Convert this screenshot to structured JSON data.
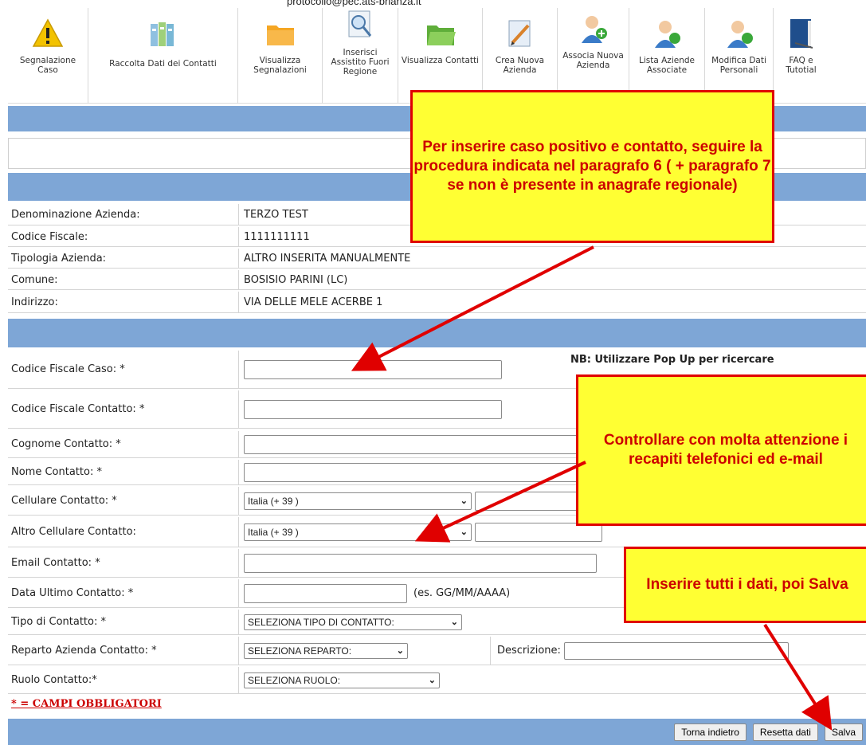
{
  "header": {
    "email": "protocollo@pec.ats-brianza.it"
  },
  "toolbar": [
    {
      "label": "Segnalazione Caso",
      "icon": "warning-icon",
      "w": 100
    },
    {
      "label": "Raccolta Dati dei Contatti",
      "icon": "books-icon",
      "w": 190
    },
    {
      "label": "Visualizza Segnalazioni",
      "icon": "folder-icon",
      "w": 105
    },
    {
      "label": "Inserisci Assistito Fuori Regione",
      "icon": "search-doc-icon",
      "w": 95
    },
    {
      "label": "Visualizza Contatti",
      "icon": "open-folder-icon",
      "w": 105
    },
    {
      "label": "Crea Nuova Azienda",
      "icon": "pencil-doc-icon",
      "w": 95
    },
    {
      "label": "Associa Nuova Azienda",
      "icon": "add-user-icon",
      "w": 90
    },
    {
      "label": "Lista Aziende Associate",
      "icon": "user-icon",
      "w": 95
    },
    {
      "label": "Modifica Dati Personali",
      "icon": "user-edit-icon",
      "w": 85
    },
    {
      "label": "FAQ e Tutotial",
      "icon": "book-icon",
      "w": 60
    }
  ],
  "company": {
    "rows": [
      {
        "label": "Denominazione Azienda:",
        "value": "TERZO TEST"
      },
      {
        "label": "Codice Fiscale:",
        "value": "1111111111"
      },
      {
        "label": "Tipologia Azienda:",
        "value": "ALTRO INSERITA MANUALMENTE"
      },
      {
        "label": "Comune:",
        "value": "BOSISIO PARINI (LC)"
      },
      {
        "label": "Indirizzo:",
        "value": "VIA DELLE MELE ACERBE 1"
      }
    ]
  },
  "form": {
    "cf_caso": "Codice Fiscale Caso: *",
    "nb_note": "NB: Utilizzare Pop Up per ricercare",
    "cf_contatto": "Codice Fiscale Contatto: *",
    "cognome": "Cognome Contatto: *",
    "nome": "Nome Contatto: *",
    "cellulare": "Cellulare Contatto: *",
    "cellulare_prefix": "Italia (+ 39 )",
    "altro_cellulare": "Altro Cellulare Contatto:",
    "altro_cellulare_prefix": "Italia (+ 39 )",
    "email": "Email Contatto: *",
    "data_ultimo": "Data Ultimo Contatto: *",
    "data_hint": "(es. GG/MM/AAAA)",
    "tipo": "Tipo di Contatto: *",
    "tipo_value": "SELEZIONA TIPO DI CONTATTO:",
    "reparto": "Reparto Azienda Contatto: *",
    "reparto_value": "SELEZIONA REPARTO:",
    "descrizione": "Descrizione:",
    "ruolo": "Ruolo Contatto:*",
    "ruolo_value": "SELEZIONA RUOLO:",
    "required_note": "* = CAMPI OBBLIGATORI"
  },
  "buttons": {
    "back": "Torna indietro",
    "reset": "Resetta dati",
    "save": "Salva"
  },
  "callouts": {
    "one": "Per inserire caso positivo e contatto, seguire la procedura indicata nel paragrafo 6 ( + paragrafo 7 se non è presente in anagrafe regionale)",
    "two": "Controllare con molta attenzione i recapiti telefonici ed e-mail",
    "three": "Inserire tutti i dati, poi Salva"
  },
  "colors": {
    "bar": "#7ea6d6",
    "callout_bg": "#ffff33",
    "callout_border": "#e00000",
    "required": "#cc0000"
  }
}
